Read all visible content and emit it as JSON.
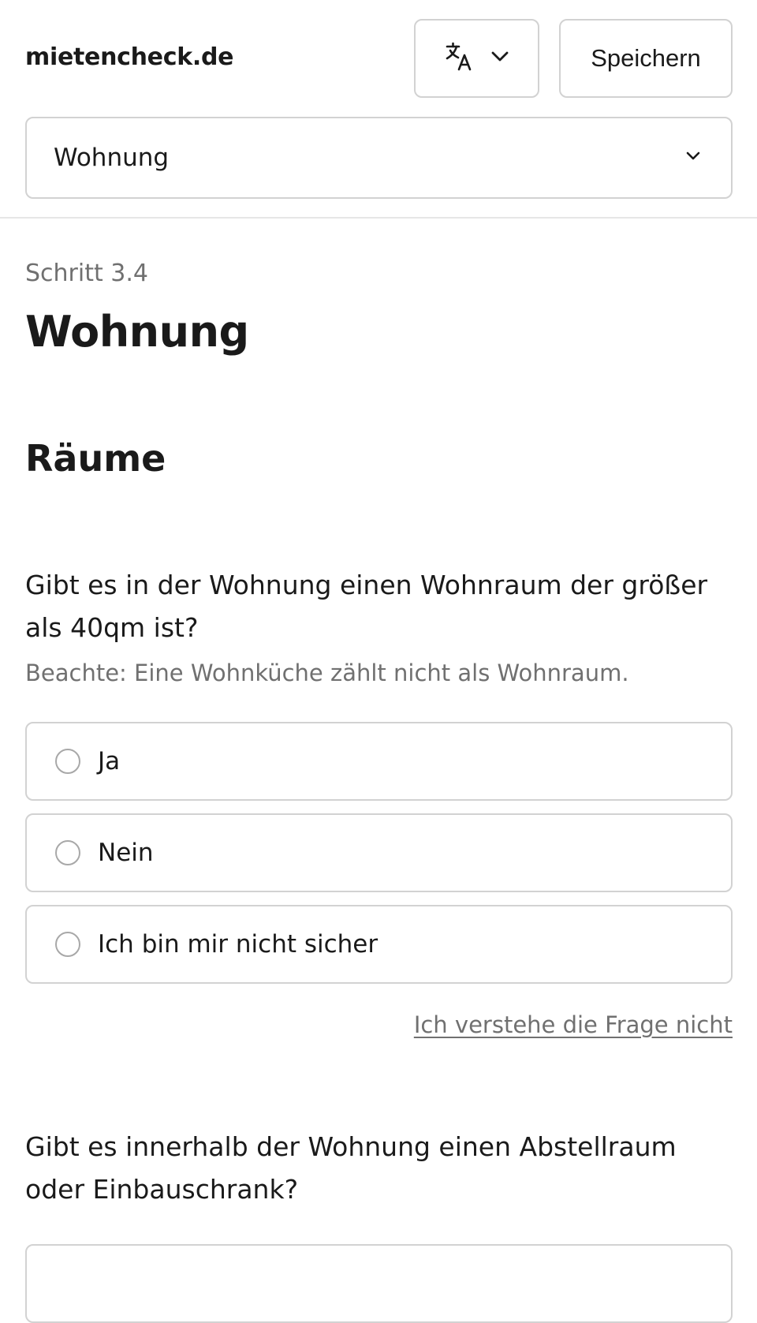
{
  "header": {
    "site_name": "mietencheck.de",
    "language_icon": "translate-icon",
    "language_chevron_icon": "chevron-down-icon",
    "save_label": "Speichern"
  },
  "section_select": {
    "value": "Wohnung",
    "chevron_icon": "chevron-down-icon"
  },
  "main": {
    "step": "Schritt 3.4",
    "title": "Wohnung",
    "section_heading": "Räume",
    "questions": [
      {
        "text": "Gibt es in der Wohnung einen Wohnraum der größer als 40qm ist?",
        "hint": "Beachte: Eine Wohnküche zählt nicht als Wohnraum.",
        "options": [
          {
            "label": "Ja",
            "selected": false
          },
          {
            "label": "Nein",
            "selected": false
          },
          {
            "label": "Ich bin mir nicht sicher",
            "selected": false
          }
        ],
        "help_link": "Ich verstehe die Frage nicht"
      },
      {
        "text": "Gibt es innerhalb der Wohnung einen Abstellraum oder Einbauschrank?"
      }
    ]
  },
  "colors": {
    "text": "#1a1a1a",
    "muted": "#707070",
    "border": "#d2d2d2",
    "divider": "#e6e6e6"
  }
}
